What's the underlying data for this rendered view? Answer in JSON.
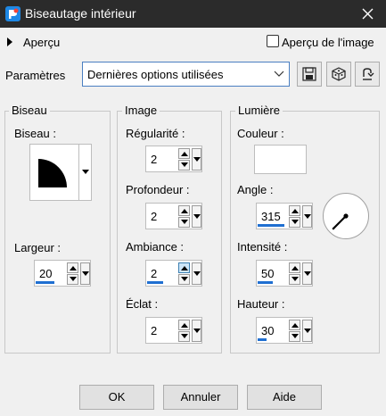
{
  "window": {
    "title": "Biseautage intérieur"
  },
  "preview": {
    "label": "Aperçu",
    "checkbox_label": "Aperçu de l'image",
    "checked": false
  },
  "params": {
    "label": "Paramètres",
    "preset_value": "Dernières options utilisées"
  },
  "bevel": {
    "group_title": "Biseau",
    "bevel_label": "Biseau :",
    "width_label": "Largeur :",
    "width_value": "20",
    "width_fraction": 0.63
  },
  "image": {
    "group_title": "Image",
    "fields": [
      {
        "label": "Régularité :",
        "value": "2",
        "fraction": 0.0
      },
      {
        "label": "Profondeur :",
        "value": "2",
        "fraction": 0.0
      },
      {
        "label": "Ambiance :",
        "value": "2",
        "fraction": 0.56
      },
      {
        "label": "Éclat :",
        "value": "2",
        "fraction": 0.0
      }
    ]
  },
  "light": {
    "group_title": "Lumière",
    "color_label": "Couleur :",
    "color_value": "#ffffff",
    "angle_label": "Angle :",
    "angle_value": "315",
    "angle_fraction": 0.92,
    "intensity_label": "Intensité :",
    "intensity_value": "50",
    "intensity_fraction": 0.5,
    "height_label": "Hauteur :",
    "height_value": "30",
    "height_fraction": 0.3
  },
  "buttons": {
    "ok": "OK",
    "cancel": "Annuler",
    "help": "Aide"
  },
  "colors": {
    "titlebar": "#2b2b2b",
    "accent": "#1f6fd1",
    "background": "#f0f0f0"
  }
}
